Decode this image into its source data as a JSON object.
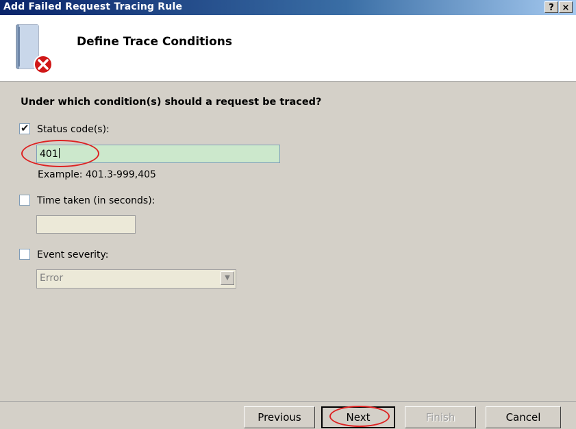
{
  "window": {
    "title": "Add Failed Request Tracing Rule",
    "help_button": "?",
    "close_button": "×"
  },
  "header": {
    "heading": "Define Trace Conditions",
    "icon": "document-error-icon"
  },
  "form": {
    "question": "Under which condition(s) should a request be traced?",
    "status_code": {
      "label": "Status code(s):",
      "checked": true,
      "value": "401",
      "example": "Example: 401.3-999,405"
    },
    "time_taken": {
      "label": "Time taken (in seconds):",
      "checked": false,
      "value": ""
    },
    "event_severity": {
      "label": "Event severity:",
      "checked": false,
      "selected": "Error"
    }
  },
  "buttons": {
    "previous": "Previous",
    "next": "Next",
    "finish": "Finish",
    "cancel": "Cancel"
  },
  "colors": {
    "annotation": "#dd2222",
    "titlebar": "#0a246a",
    "active_input": "#cce8cc"
  }
}
